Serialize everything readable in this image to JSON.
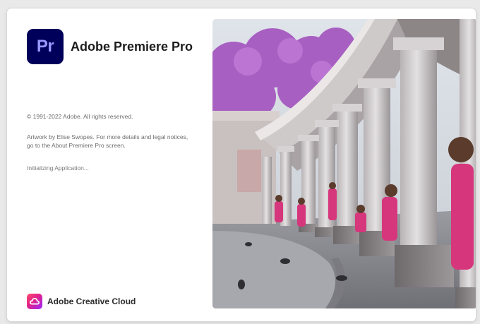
{
  "app": {
    "logo_text": "Pr",
    "title": "Adobe Premiere Pro",
    "brand_color": "#00005b",
    "logo_text_color": "#9999ff"
  },
  "copyright": "© 1991-2022 Adobe. All rights reserved.",
  "artwork_credit": "Artwork by Elise Swopes. For more details and legal notices, go to the About Premiere Pro screen.",
  "status": "Initializing Application...",
  "footer": {
    "label": "Adobe Creative Cloud",
    "icon": "creative-cloud-icon"
  }
}
